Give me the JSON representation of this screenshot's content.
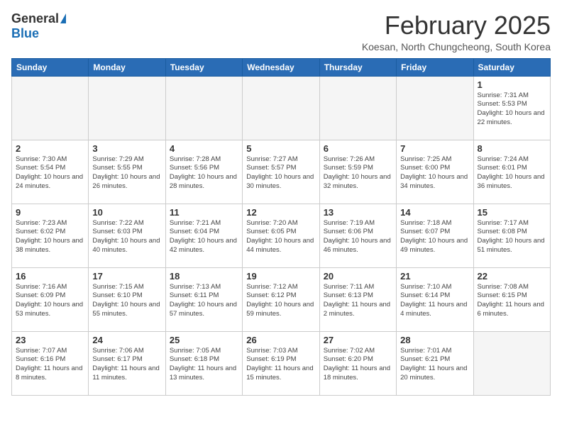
{
  "header": {
    "logo_general": "General",
    "logo_blue": "Blue",
    "month_title": "February 2025",
    "subtitle": "Koesan, North Chungcheong, South Korea"
  },
  "days_of_week": [
    "Sunday",
    "Monday",
    "Tuesday",
    "Wednesday",
    "Thursday",
    "Friday",
    "Saturday"
  ],
  "weeks": [
    [
      {
        "day": "",
        "info": ""
      },
      {
        "day": "",
        "info": ""
      },
      {
        "day": "",
        "info": ""
      },
      {
        "day": "",
        "info": ""
      },
      {
        "day": "",
        "info": ""
      },
      {
        "day": "",
        "info": ""
      },
      {
        "day": "1",
        "info": "Sunrise: 7:31 AM\nSunset: 5:53 PM\nDaylight: 10 hours\nand 22 minutes."
      }
    ],
    [
      {
        "day": "2",
        "info": "Sunrise: 7:30 AM\nSunset: 5:54 PM\nDaylight: 10 hours\nand 24 minutes."
      },
      {
        "day": "3",
        "info": "Sunrise: 7:29 AM\nSunset: 5:55 PM\nDaylight: 10 hours\nand 26 minutes."
      },
      {
        "day": "4",
        "info": "Sunrise: 7:28 AM\nSunset: 5:56 PM\nDaylight: 10 hours\nand 28 minutes."
      },
      {
        "day": "5",
        "info": "Sunrise: 7:27 AM\nSunset: 5:57 PM\nDaylight: 10 hours\nand 30 minutes."
      },
      {
        "day": "6",
        "info": "Sunrise: 7:26 AM\nSunset: 5:59 PM\nDaylight: 10 hours\nand 32 minutes."
      },
      {
        "day": "7",
        "info": "Sunrise: 7:25 AM\nSunset: 6:00 PM\nDaylight: 10 hours\nand 34 minutes."
      },
      {
        "day": "8",
        "info": "Sunrise: 7:24 AM\nSunset: 6:01 PM\nDaylight: 10 hours\nand 36 minutes."
      }
    ],
    [
      {
        "day": "9",
        "info": "Sunrise: 7:23 AM\nSunset: 6:02 PM\nDaylight: 10 hours\nand 38 minutes."
      },
      {
        "day": "10",
        "info": "Sunrise: 7:22 AM\nSunset: 6:03 PM\nDaylight: 10 hours\nand 40 minutes."
      },
      {
        "day": "11",
        "info": "Sunrise: 7:21 AM\nSunset: 6:04 PM\nDaylight: 10 hours\nand 42 minutes."
      },
      {
        "day": "12",
        "info": "Sunrise: 7:20 AM\nSunset: 6:05 PM\nDaylight: 10 hours\nand 44 minutes."
      },
      {
        "day": "13",
        "info": "Sunrise: 7:19 AM\nSunset: 6:06 PM\nDaylight: 10 hours\nand 46 minutes."
      },
      {
        "day": "14",
        "info": "Sunrise: 7:18 AM\nSunset: 6:07 PM\nDaylight: 10 hours\nand 49 minutes."
      },
      {
        "day": "15",
        "info": "Sunrise: 7:17 AM\nSunset: 6:08 PM\nDaylight: 10 hours\nand 51 minutes."
      }
    ],
    [
      {
        "day": "16",
        "info": "Sunrise: 7:16 AM\nSunset: 6:09 PM\nDaylight: 10 hours\nand 53 minutes."
      },
      {
        "day": "17",
        "info": "Sunrise: 7:15 AM\nSunset: 6:10 PM\nDaylight: 10 hours\nand 55 minutes."
      },
      {
        "day": "18",
        "info": "Sunrise: 7:13 AM\nSunset: 6:11 PM\nDaylight: 10 hours\nand 57 minutes."
      },
      {
        "day": "19",
        "info": "Sunrise: 7:12 AM\nSunset: 6:12 PM\nDaylight: 10 hours\nand 59 minutes."
      },
      {
        "day": "20",
        "info": "Sunrise: 7:11 AM\nSunset: 6:13 PM\nDaylight: 11 hours\nand 2 minutes."
      },
      {
        "day": "21",
        "info": "Sunrise: 7:10 AM\nSunset: 6:14 PM\nDaylight: 11 hours\nand 4 minutes."
      },
      {
        "day": "22",
        "info": "Sunrise: 7:08 AM\nSunset: 6:15 PM\nDaylight: 11 hours\nand 6 minutes."
      }
    ],
    [
      {
        "day": "23",
        "info": "Sunrise: 7:07 AM\nSunset: 6:16 PM\nDaylight: 11 hours\nand 8 minutes."
      },
      {
        "day": "24",
        "info": "Sunrise: 7:06 AM\nSunset: 6:17 PM\nDaylight: 11 hours\nand 11 minutes."
      },
      {
        "day": "25",
        "info": "Sunrise: 7:05 AM\nSunset: 6:18 PM\nDaylight: 11 hours\nand 13 minutes."
      },
      {
        "day": "26",
        "info": "Sunrise: 7:03 AM\nSunset: 6:19 PM\nDaylight: 11 hours\nand 15 minutes."
      },
      {
        "day": "27",
        "info": "Sunrise: 7:02 AM\nSunset: 6:20 PM\nDaylight: 11 hours\nand 18 minutes."
      },
      {
        "day": "28",
        "info": "Sunrise: 7:01 AM\nSunset: 6:21 PM\nDaylight: 11 hours\nand 20 minutes."
      },
      {
        "day": "",
        "info": ""
      }
    ]
  ]
}
